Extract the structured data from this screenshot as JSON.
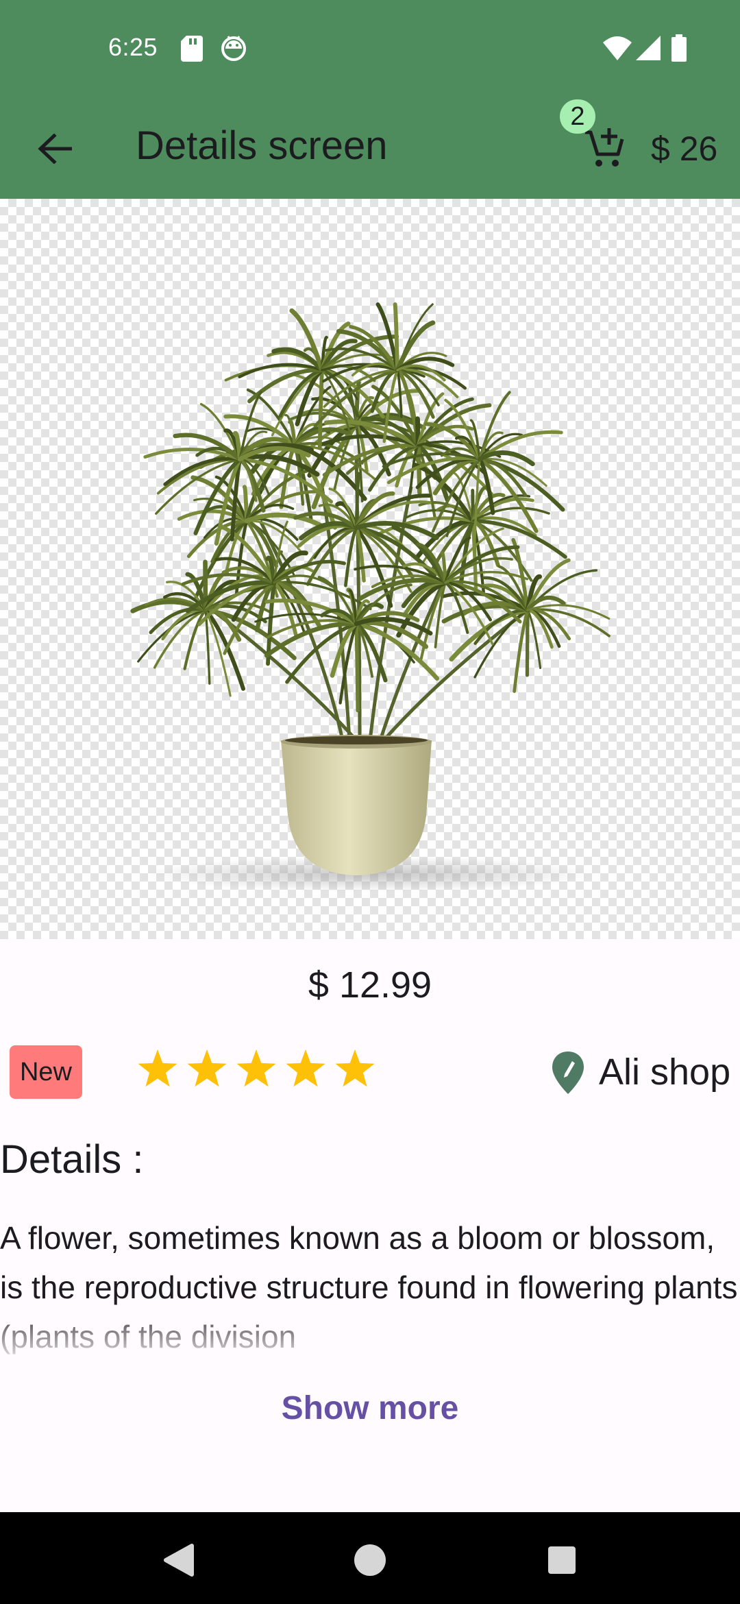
{
  "status_bar": {
    "time": "6:25",
    "left_icons": [
      "sd-card-icon",
      "android-debug-icon"
    ],
    "right_icons": [
      "wifi-icon",
      "cellular-signal-icon",
      "battery-icon"
    ]
  },
  "app_bar": {
    "back_icon": "arrow-back-icon",
    "title": "Details screen",
    "cart_icon": "add-shopping-cart-icon",
    "cart_count": "2",
    "cart_total": "$ 26"
  },
  "product": {
    "image": "potted-palm-plant",
    "price": "$  12.99",
    "badge": "New",
    "rating": 5,
    "rating_max": 5,
    "shop_icon": "location-pin-icon",
    "shop_name": "Ali shop"
  },
  "details": {
    "heading": "Details :",
    "body": "A flower, sometimes known as a bloom or blossom, is the reproductive structure found in flowering plants (plants of the division",
    "show_more": "Show more"
  },
  "nav_bar": {
    "buttons": [
      "back-triangle-icon",
      "home-circle-icon",
      "recents-square-icon"
    ]
  },
  "colors": {
    "primary_green": "#4f8c5d",
    "badge_green": "#a6efb0",
    "new_badge": "#ff7b7b",
    "star": "#ffc107",
    "pin": "#4f7a63",
    "link": "#6650a4"
  }
}
